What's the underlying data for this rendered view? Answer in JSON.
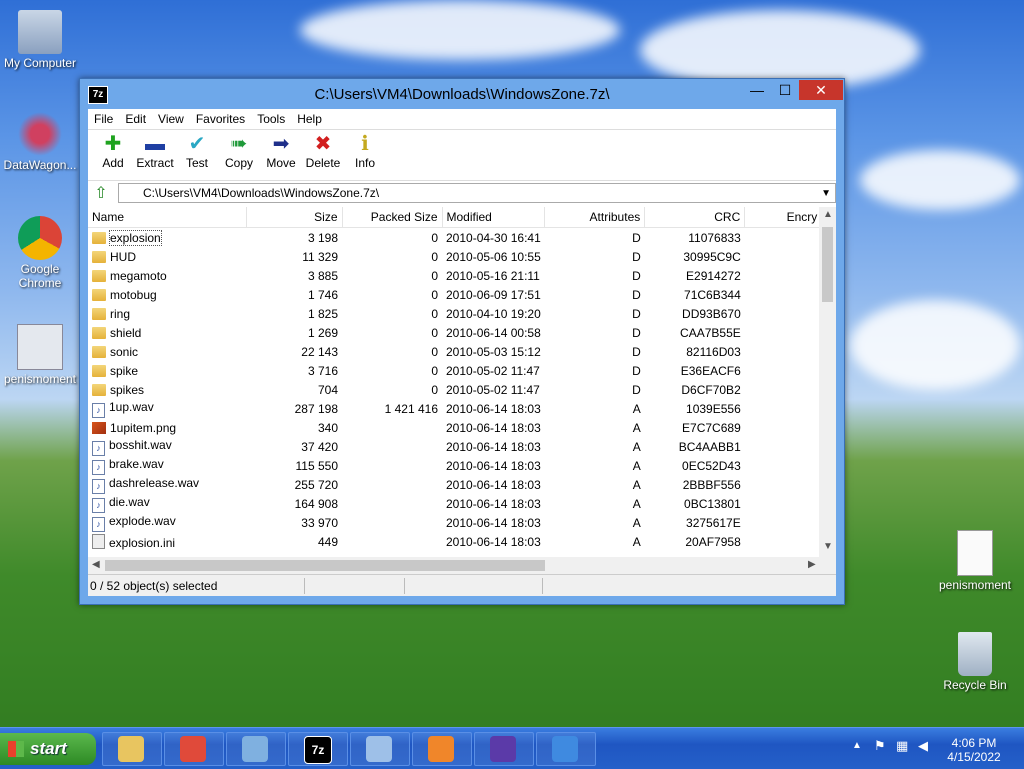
{
  "desktop": {
    "icons": [
      {
        "label": "My Computer"
      },
      {
        "label": "DataWagon..."
      },
      {
        "label": "Google Chrome"
      },
      {
        "label": "penismoment"
      },
      {
        "label": "penismoment"
      },
      {
        "label": "Recycle Bin"
      }
    ]
  },
  "window": {
    "app_icon_label": "7z",
    "title": "C:\\Users\\VM4\\Downloads\\WindowsZone.7z\\",
    "min_glyph": "—",
    "max_glyph": "☐",
    "close_glyph": "✕"
  },
  "menu": [
    "File",
    "Edit",
    "View",
    "Favorites",
    "Tools",
    "Help"
  ],
  "toolbar": [
    {
      "label": "Add",
      "icon": "plus-icon",
      "glyph": "✚",
      "color": "#1fa31f"
    },
    {
      "label": "Extract",
      "icon": "minus-icon",
      "glyph": "▬",
      "color": "#1f3fa3"
    },
    {
      "label": "Test",
      "icon": "check-icon",
      "glyph": "✔",
      "color": "#2aa8c4"
    },
    {
      "label": "Copy",
      "icon": "copy-arrow-icon",
      "glyph": "➠",
      "color": "#1f9a3a"
    },
    {
      "label": "Move",
      "icon": "move-arrow-icon",
      "glyph": "➡",
      "color": "#1f2f8a"
    },
    {
      "label": "Delete",
      "icon": "delete-x-icon",
      "glyph": "✖",
      "color": "#d21f1f"
    },
    {
      "label": "Info",
      "icon": "info-icon",
      "glyph": "ℹ",
      "color": "#c4a91f"
    }
  ],
  "address": {
    "path": "C:\\Users\\VM4\\Downloads\\WindowsZone.7z\\"
  },
  "columns": [
    "Name",
    "Size",
    "Packed Size",
    "Modified",
    "Attributes",
    "CRC",
    "Encry"
  ],
  "rows": [
    {
      "type": "folder",
      "name": "explosion",
      "size": "3 198",
      "packed": "0",
      "modified": "2010-04-30 16:41",
      "attr": "D",
      "crc": "11076833"
    },
    {
      "type": "folder",
      "name": "HUD",
      "size": "11 329",
      "packed": "0",
      "modified": "2010-05-06 10:55",
      "attr": "D",
      "crc": "30995C9C"
    },
    {
      "type": "folder",
      "name": "megamoto",
      "size": "3 885",
      "packed": "0",
      "modified": "2010-05-16 21:11",
      "attr": "D",
      "crc": "E2914272"
    },
    {
      "type": "folder",
      "name": "motobug",
      "size": "1 746",
      "packed": "0",
      "modified": "2010-06-09 17:51",
      "attr": "D",
      "crc": "71C6B344"
    },
    {
      "type": "folder",
      "name": "ring",
      "size": "1 825",
      "packed": "0",
      "modified": "2010-04-10 19:20",
      "attr": "D",
      "crc": "DD93B670"
    },
    {
      "type": "folder",
      "name": "shield",
      "size": "1 269",
      "packed": "0",
      "modified": "2010-06-14 00:58",
      "attr": "D",
      "crc": "CAA7B55E"
    },
    {
      "type": "folder",
      "name": "sonic",
      "size": "22 143",
      "packed": "0",
      "modified": "2010-05-03 15:12",
      "attr": "D",
      "crc": "82116D03"
    },
    {
      "type": "folder",
      "name": "spike",
      "size": "3 716",
      "packed": "0",
      "modified": "2010-05-02 11:47",
      "attr": "D",
      "crc": "E36EACF6"
    },
    {
      "type": "folder",
      "name": "spikes",
      "size": "704",
      "packed": "0",
      "modified": "2010-05-02 11:47",
      "attr": "D",
      "crc": "D6CF70B2"
    },
    {
      "type": "wav",
      "name": "1up.wav",
      "size": "287 198",
      "packed": "1 421 416",
      "modified": "2010-06-14 18:03",
      "attr": "A",
      "crc": "1039E556"
    },
    {
      "type": "png",
      "name": "1upitem.png",
      "size": "340",
      "packed": "",
      "modified": "2010-06-14 18:03",
      "attr": "A",
      "crc": "E7C7C689"
    },
    {
      "type": "wav",
      "name": "bosshit.wav",
      "size": "37 420",
      "packed": "",
      "modified": "2010-06-14 18:03",
      "attr": "A",
      "crc": "BC4AABB1"
    },
    {
      "type": "wav",
      "name": "brake.wav",
      "size": "115 550",
      "packed": "",
      "modified": "2010-06-14 18:03",
      "attr": "A",
      "crc": "0EC52D43"
    },
    {
      "type": "wav",
      "name": "dashrelease.wav",
      "size": "255 720",
      "packed": "",
      "modified": "2010-06-14 18:03",
      "attr": "A",
      "crc": "2BBBF556"
    },
    {
      "type": "wav",
      "name": "die.wav",
      "size": "164 908",
      "packed": "",
      "modified": "2010-06-14 18:03",
      "attr": "A",
      "crc": "0BC13801"
    },
    {
      "type": "wav",
      "name": "explode.wav",
      "size": "33 970",
      "packed": "",
      "modified": "2010-06-14 18:03",
      "attr": "A",
      "crc": "3275617E"
    },
    {
      "type": "ini",
      "name": "explosion.ini",
      "size": "449",
      "packed": "",
      "modified": "2010-06-14 18:03",
      "attr": "A",
      "crc": "20AF7958"
    }
  ],
  "status": {
    "selected": "0 / 52 object(s) selected"
  },
  "taskbar": {
    "start_label": "start",
    "apps": [
      {
        "icon": "file-explorer-icon",
        "color": "#e8c560"
      },
      {
        "icon": "chrome-icon",
        "color": "#e04a3a"
      },
      {
        "icon": "control-panel-icon",
        "color": "#7fb0e0"
      },
      {
        "icon": "7zip-icon",
        "color": "#000000",
        "label": "7z"
      },
      {
        "icon": "performance-monitor-icon",
        "color": "#9ec0e8"
      },
      {
        "icon": "firefox-icon",
        "color": "#f0862a"
      },
      {
        "icon": "trophy-icon",
        "color": "#5b3aa8"
      },
      {
        "icon": "sun-brightness-icon",
        "color": "#3f8ae0"
      }
    ],
    "clock": {
      "time": "4:06 PM",
      "date": "4/15/2022"
    }
  }
}
